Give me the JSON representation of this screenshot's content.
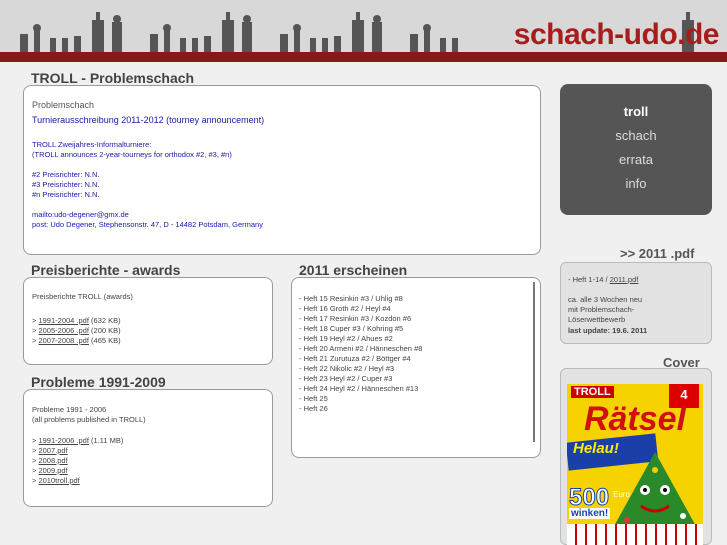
{
  "banner": {
    "brand": "schach-udo.de"
  },
  "troll": {
    "title": "TROLL - Problemschach",
    "subtitle": "Problemschach",
    "announcement": "Turnierausschreibung 2011-2012 (tourney announcement)",
    "lines": [
      "TROLL Zweijahres-Informalturniere:",
      "(TROLL announces 2-year-tourneys for orthodox #2, #3, #n)",
      "",
      "#2 Preisrichter: N.N.",
      "#3 Preisrichter: N.N.",
      "#n Preisrichter: N.N.",
      "",
      "mailto:udo-degener@gmx.de",
      "post: Udo Degener, Stephensonstr. 47, D - 14482 Potsdam, Germany"
    ]
  },
  "awards": {
    "title": "Preisberichte - awards",
    "intro": "Preisberichte TROLL (awards)",
    "files": [
      {
        "prefix": "> ",
        "link": "1991-2004 .pdf",
        "size": " (632 KB)"
      },
      {
        "prefix": "> ",
        "link": "2005-2006 .pdf",
        "size": " (200 KB)"
      },
      {
        "prefix": "> ",
        "link": "2007-2008 .pdf",
        "size": " (465 KB)"
      }
    ]
  },
  "problems": {
    "title": "Probleme 1991-2009",
    "intro1": "Probleme 1991 - 2006",
    "intro2": "(all problems published in TROLL)",
    "files": [
      {
        "prefix": "> ",
        "link": "1991-2006 .pdf",
        "size": " (1.11 MB)"
      },
      {
        "prefix": "> ",
        "link": "2007.pdf",
        "size": ""
      },
      {
        "prefix": "> ",
        "link": "2008.pdf",
        "size": ""
      },
      {
        "prefix": "> ",
        "link": "2009.pdf",
        "size": ""
      },
      {
        "prefix": "> ",
        "link": "2010troll.pdf",
        "size": ""
      }
    ]
  },
  "issues": {
    "title": "2011 erscheinen",
    "items": [
      "- Heft 15 Resinkin #3 / Uhlig #8",
      "- Heft 16 Groth #2 / Heyl #4",
      "- Heft 17 Resinkin #3 / Kozdon #6",
      "- Heft 18 Cuper #3 / Kohring #5",
      "- Heft 19 Heyl #2 / Ahues #2",
      "- Heft 20 Armeni #2 / Hänneschen #8",
      "- Heft 21 Zurutuza #2 / Böttger #4",
      "- Heft 22 Nikolic #2 / Heyl #3",
      "- Heft 23 Heyl #2 / Cuper #3",
      "- Heft 24 Heyl #2 / Hänneschen #13",
      "- Heft 25",
      "- Heft 26"
    ]
  },
  "nav": {
    "items": [
      "troll",
      "schach",
      "errata",
      "info"
    ]
  },
  "pdf": {
    "title": ">> 2011 .pdf",
    "line1_prefix": "- Heft 1-14 / ",
    "line1_link": "2011.pdf",
    "lines": [
      "ca. alle 3 Wochen neu",
      "mit Problemschach-",
      "Löserwettbewerb"
    ],
    "update": "last update: 19.6. 2011"
  },
  "cover": {
    "title": "Cover",
    "logo": "TROLL",
    "magazine": "Rätsel",
    "number": "4",
    "helau": "Helau!",
    "prize": "500",
    "prize_sub": "Euro",
    "win": "winken!"
  },
  "colors": {
    "brand": "#a81c1c",
    "stripe": "#8a1818",
    "link_blue": "#1a1aa8",
    "nav_bg": "#555555"
  }
}
